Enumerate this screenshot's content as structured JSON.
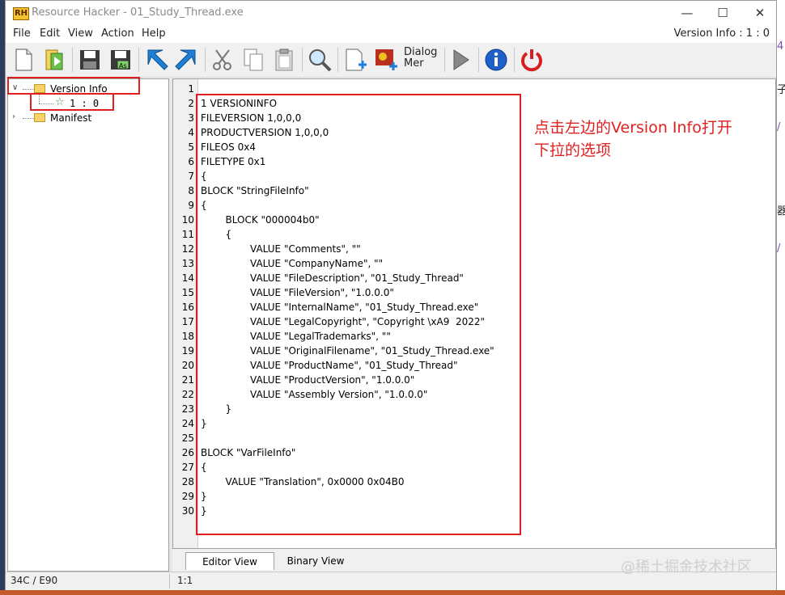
{
  "window": {
    "title": "Resource Hacker - 01_Study_Thread.exe",
    "app_icon_text": "RH",
    "controls": {
      "minimize": "—",
      "maximize": "☐",
      "close": "✕"
    }
  },
  "menu": {
    "items": [
      "File",
      "Edit",
      "View",
      "Action",
      "Help"
    ],
    "version_label": "Version Info : 1 : 0"
  },
  "toolbar": {
    "dialog_label_1": "Dialog",
    "dialog_label_2": "Mer"
  },
  "tree": {
    "items": [
      {
        "label": "Version Info"
      },
      {
        "label": "1 : 0"
      },
      {
        "label": "Manifest"
      }
    ]
  },
  "editor": {
    "line_numbers": [
      "1",
      "2",
      "3",
      "4",
      "5",
      "6",
      "7",
      "8",
      "9",
      "10",
      "11",
      "12",
      "13",
      "14",
      "15",
      "16",
      "17",
      "18",
      "19",
      "20",
      "21",
      "22",
      "23",
      "24",
      "25",
      "26",
      "27",
      "28",
      "29",
      "30"
    ],
    "lines": [
      "",
      "1 VERSIONINFO",
      "FILEVERSION 1,0,0,0",
      "PRODUCTVERSION 1,0,0,0",
      "FILEOS 0x4",
      "FILETYPE 0x1",
      "{",
      "BLOCK \"StringFileInfo\"",
      "{",
      "        BLOCK \"000004b0\"",
      "        {",
      "                VALUE \"Comments\", \"\"",
      "                VALUE \"CompanyName\", \"\"",
      "                VALUE \"FileDescription\", \"01_Study_Thread\"",
      "                VALUE \"FileVersion\", \"1.0.0.0\"",
      "                VALUE \"InternalName\", \"01_Study_Thread.exe\"",
      "                VALUE \"LegalCopyright\", \"Copyright \\xA9  2022\"",
      "                VALUE \"LegalTrademarks\", \"\"",
      "                VALUE \"OriginalFilename\", \"01_Study_Thread.exe\"",
      "                VALUE \"ProductName\", \"01_Study_Thread\"",
      "                VALUE \"ProductVersion\", \"1.0.0.0\"",
      "                VALUE \"Assembly Version\", \"1.0.0.0\"",
      "        }",
      "}",
      "",
      "BLOCK \"VarFileInfo\"",
      "{",
      "        VALUE \"Translation\", 0x0000 0x04B0",
      "}",
      "}"
    ],
    "annotation_line1": "点击左边的Version Info打开",
    "annotation_line2": "下拉的选项"
  },
  "tabs": [
    "Editor View",
    "Binary View"
  ],
  "status": {
    "left": "34C / E90",
    "right": "1:1"
  },
  "watermark": "@稀土掘金技术社区",
  "colors": {
    "annotation_red": "#e02020",
    "folder_yellow": "#f6d36a",
    "toolbar_blue": "#1e7fd6",
    "power_red": "#d62020"
  }
}
